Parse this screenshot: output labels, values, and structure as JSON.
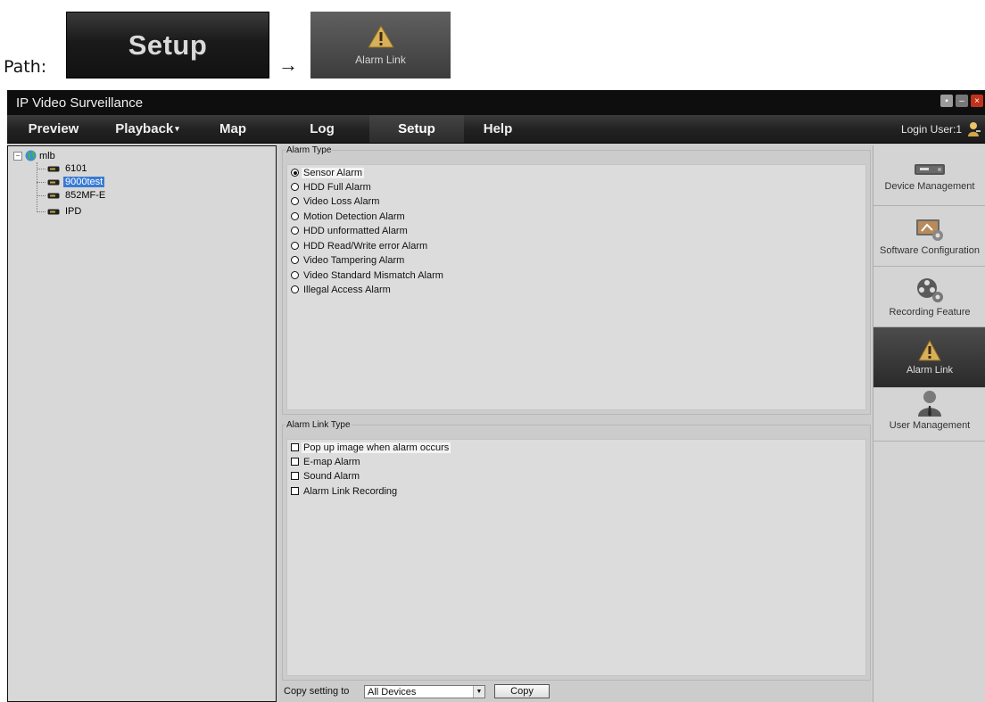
{
  "header": {
    "path_label": "Path:",
    "crumb_setup": "Setup",
    "arrow": "→",
    "crumb_alarm_link": "Alarm Link"
  },
  "window": {
    "title": "IP Video Surveillance",
    "menu": [
      {
        "label": "Preview"
      },
      {
        "label": "Playback"
      },
      {
        "label": "Map"
      },
      {
        "label": "Log"
      },
      {
        "label": "Setup"
      },
      {
        "label": "Help"
      }
    ],
    "login_user": "Login User:1"
  },
  "tree": {
    "root": "mlb",
    "devices": [
      "6101",
      "9000test",
      "852MF-E",
      "IPD"
    ],
    "selected": "9000test"
  },
  "alarm_type": {
    "legend": "Alarm Type",
    "options": [
      "Sensor Alarm",
      "HDD Full Alarm",
      "Video Loss Alarm",
      "Motion Detection Alarm",
      "HDD unformatted Alarm",
      "HDD Read/Write error Alarm",
      "Video Tampering Alarm",
      "Video Standard Mismatch Alarm",
      "Illegal Access Alarm"
    ],
    "selected": "Sensor Alarm"
  },
  "alarm_link_type": {
    "legend": "Alarm Link Type",
    "options": [
      "Pop up image when alarm occurs",
      "E-map Alarm",
      "Sound Alarm",
      "Alarm Link Recording"
    ]
  },
  "copy": {
    "label": "Copy setting to",
    "selected": "All Devices",
    "button": "Copy"
  },
  "right_nav": [
    {
      "label": "Device Management",
      "icon": "device-icon"
    },
    {
      "label": "Software Configuration",
      "icon": "software-icon"
    },
    {
      "label": "Recording Feature",
      "icon": "recording-icon"
    },
    {
      "label": "Alarm Link",
      "icon": "alarm-icon"
    },
    {
      "label": "User Management",
      "icon": "user-icon"
    }
  ],
  "colors": {
    "selection": "#3a7bd5",
    "dark_bar": "#1a1a1a",
    "panel": "#d8d8d8"
  }
}
